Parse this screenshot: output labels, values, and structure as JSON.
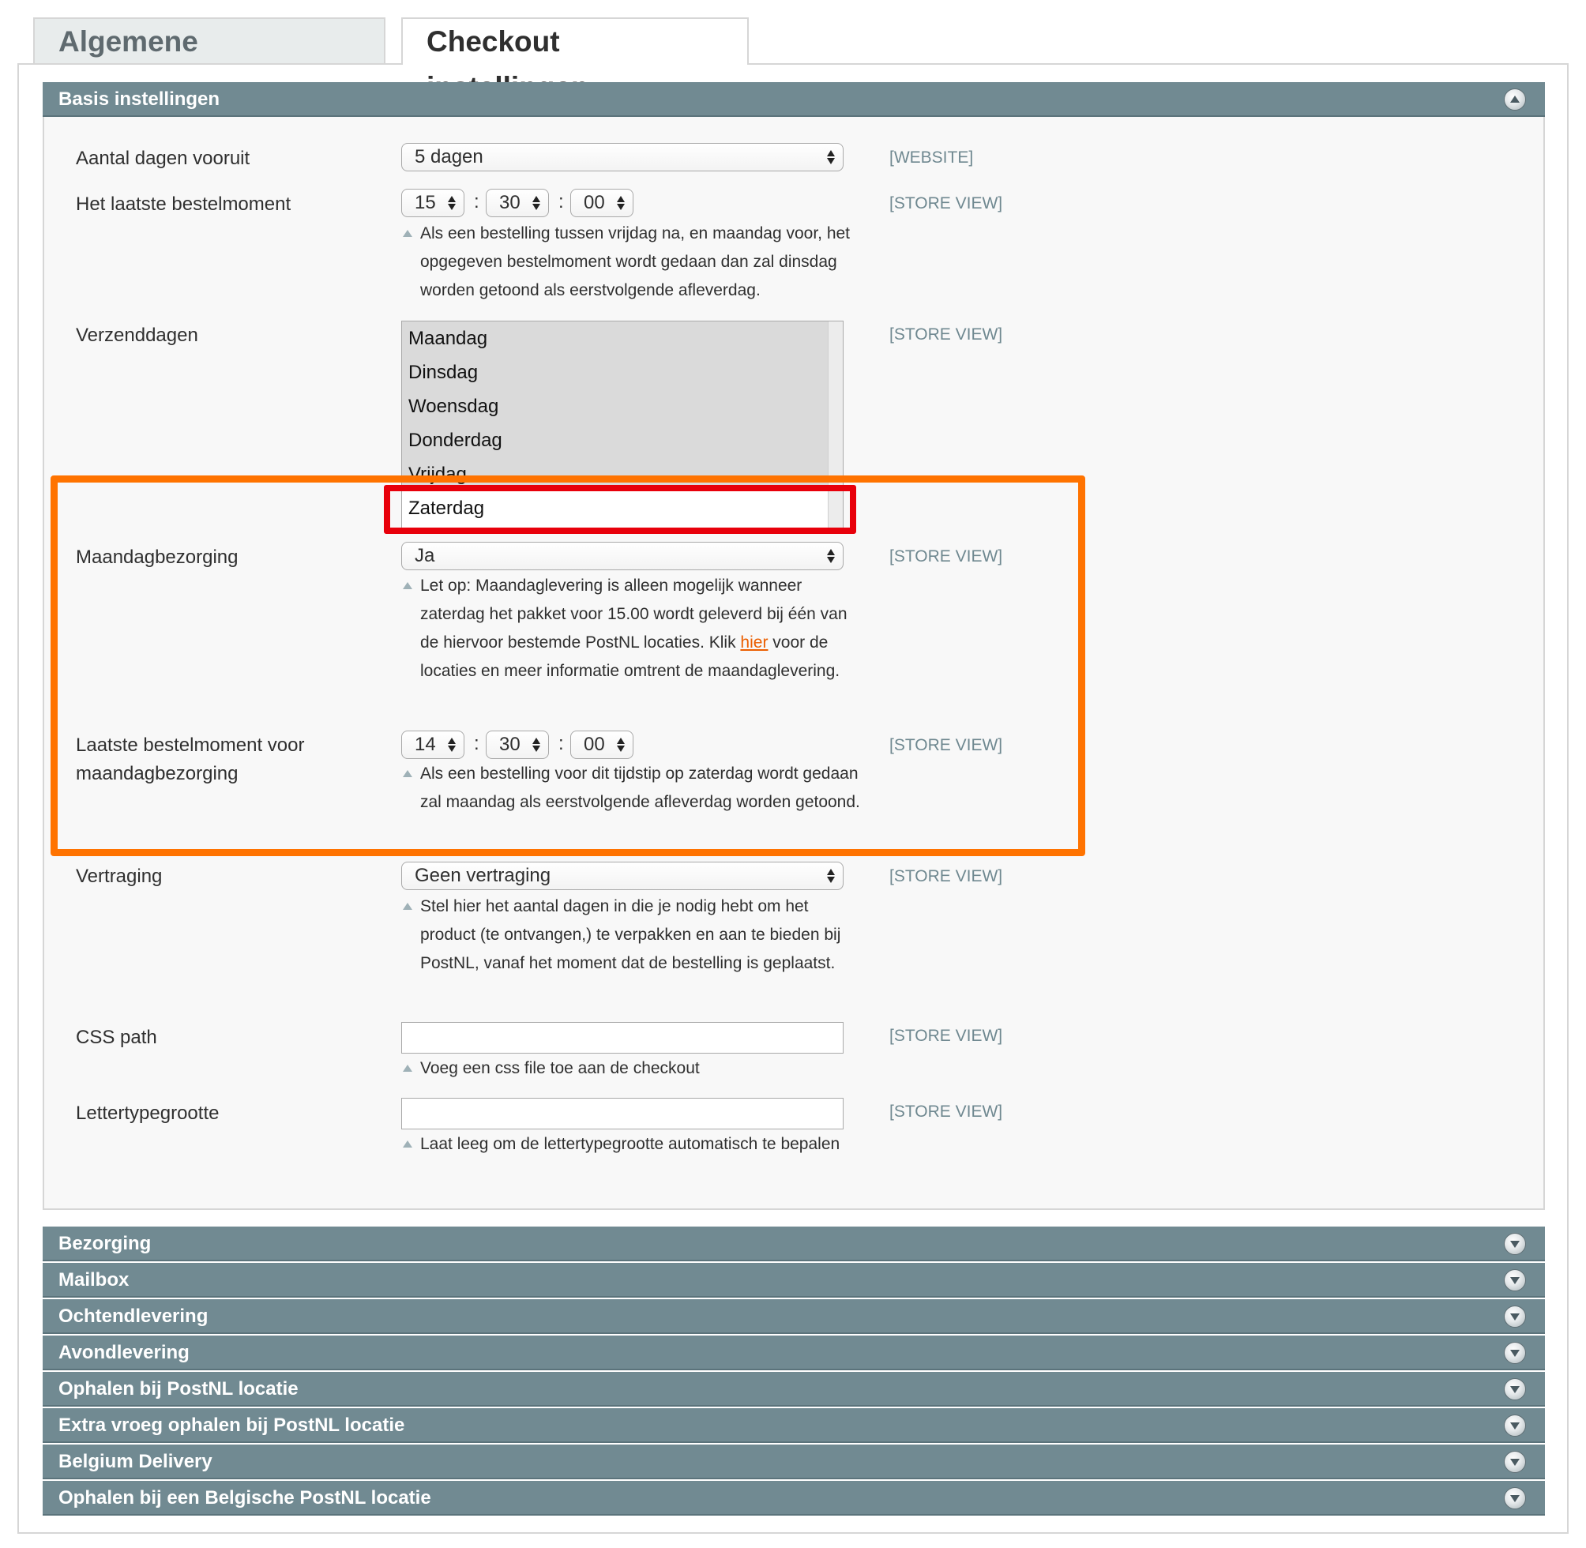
{
  "tabs": [
    {
      "label": "Algemene instellingen"
    },
    {
      "label": "Checkout instellingen"
    }
  ],
  "basis": {
    "header": "Basis instellingen",
    "fields": {
      "dagen": {
        "label": "Aantal dagen vooruit",
        "value": "5 dagen",
        "scope": "[WEBSITE]"
      },
      "bestelmoment": {
        "label": "Het laatste bestelmoment",
        "hour": "15",
        "minute": "30",
        "second": "00",
        "scope": "[STORE VIEW]",
        "note": "Als een bestelling tussen vrijdag na, en maandag voor, het opgegeven bestelmoment wordt gedaan dan zal dinsdag worden getoond als eerstvolgende afleverdag."
      },
      "verzenddagen": {
        "label": "Verzenddagen",
        "scope": "[STORE VIEW]",
        "options": [
          "Maandag",
          "Dinsdag",
          "Woensdag",
          "Donderdag",
          "Vrijdag",
          "Zaterdag"
        ]
      },
      "maandagbezorging": {
        "label": "Maandagbezorging",
        "value": "Ja",
        "scope": "[STORE VIEW]",
        "note_before": "Let op: Maandaglevering is alleen mogelijk wanneer zaterdag het pakket voor 15.00 wordt geleverd bij één van de hiervoor bestemde PostNL locaties. Klik ",
        "note_link": "hier",
        "note_after": " voor de locaties en meer informatie omtrent de maandaglevering."
      },
      "laatste_maandag": {
        "label_line1": "Laatste bestelmoment voor",
        "label_line2": "maandagbezorging",
        "hour": "14",
        "minute": "30",
        "second": "00",
        "scope": "[STORE VIEW]",
        "note": "Als een bestelling voor dit tijdstip op zaterdag wordt gedaan zal maandag als eerstvolgende afleverdag worden getoond."
      },
      "vertraging": {
        "label": "Vertraging",
        "value": "Geen vertraging",
        "scope": "[STORE VIEW]",
        "note": "Stel hier het aantal dagen in die je nodig hebt om het product (te ontvangen,) te verpakken en aan te bieden bij PostNL, vanaf het moment dat de bestelling is geplaatst."
      },
      "css_path": {
        "label": "CSS path",
        "value": "",
        "scope": "[STORE VIEW]",
        "note": "Voeg een css file toe aan de checkout"
      },
      "lettertype": {
        "label": "Lettertypegrootte",
        "value": "",
        "scope": "[STORE VIEW]",
        "note": "Laat leeg om de lettertypegrootte automatisch te bepalen"
      }
    }
  },
  "sections": [
    {
      "label": "Bezorging"
    },
    {
      "label": "Mailbox"
    },
    {
      "label": "Ochtendlevering"
    },
    {
      "label": "Avondlevering"
    },
    {
      "label": "Ophalen bij PostNL locatie"
    },
    {
      "label": "Extra vroeg ophalen bij PostNL locatie"
    },
    {
      "label": "Belgium Delivery"
    },
    {
      "label": "Ophalen bij een Belgische PostNL locatie"
    }
  ],
  "colors": {
    "highlight_outer": "#ff7300",
    "highlight_inner": "#e8000b",
    "header_bg": "#718a92",
    "link": "#eb5e00"
  }
}
